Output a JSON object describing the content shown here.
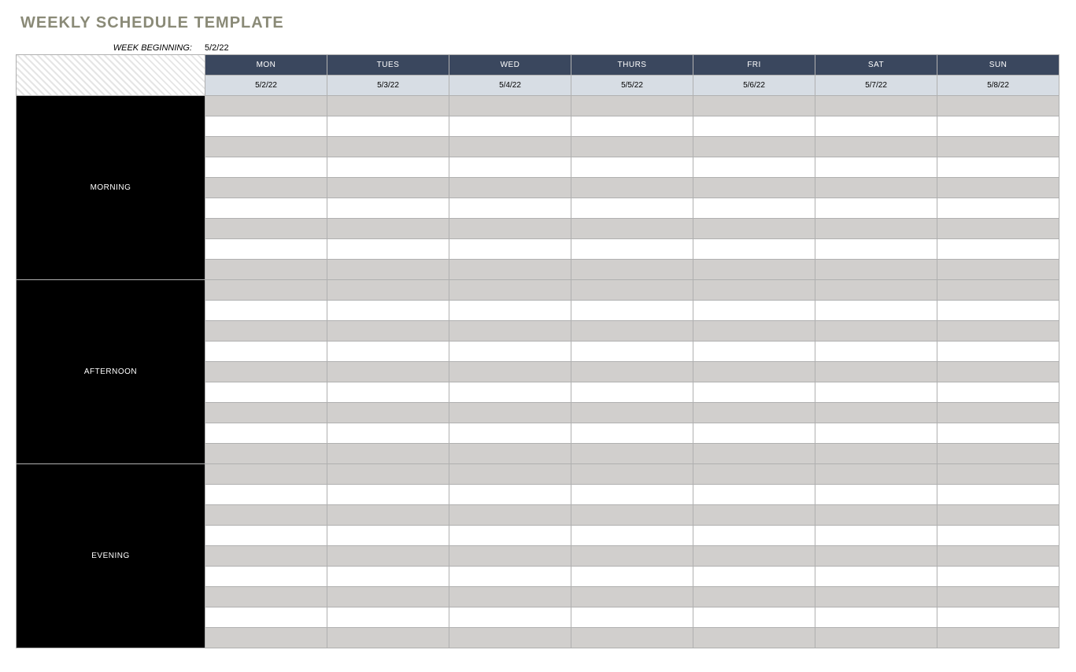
{
  "title": "WEEKLY SCHEDULE TEMPLATE",
  "week_begin_label": "WEEK BEGINNING:",
  "week_begin_value": "5/2/22",
  "days": [
    {
      "label": "MON",
      "date": "5/2/22"
    },
    {
      "label": "TUES",
      "date": "5/3/22"
    },
    {
      "label": "WED",
      "date": "5/4/22"
    },
    {
      "label": "THURS",
      "date": "5/5/22"
    },
    {
      "label": "FRI",
      "date": "5/6/22"
    },
    {
      "label": "SAT",
      "date": "5/7/22"
    },
    {
      "label": "SUN",
      "date": "5/8/22"
    }
  ],
  "sections": [
    {
      "label": "MORNING",
      "rows": 9
    },
    {
      "label": "AFTERNOON",
      "rows": 9
    },
    {
      "label": "EVENING",
      "rows": 9
    }
  ]
}
